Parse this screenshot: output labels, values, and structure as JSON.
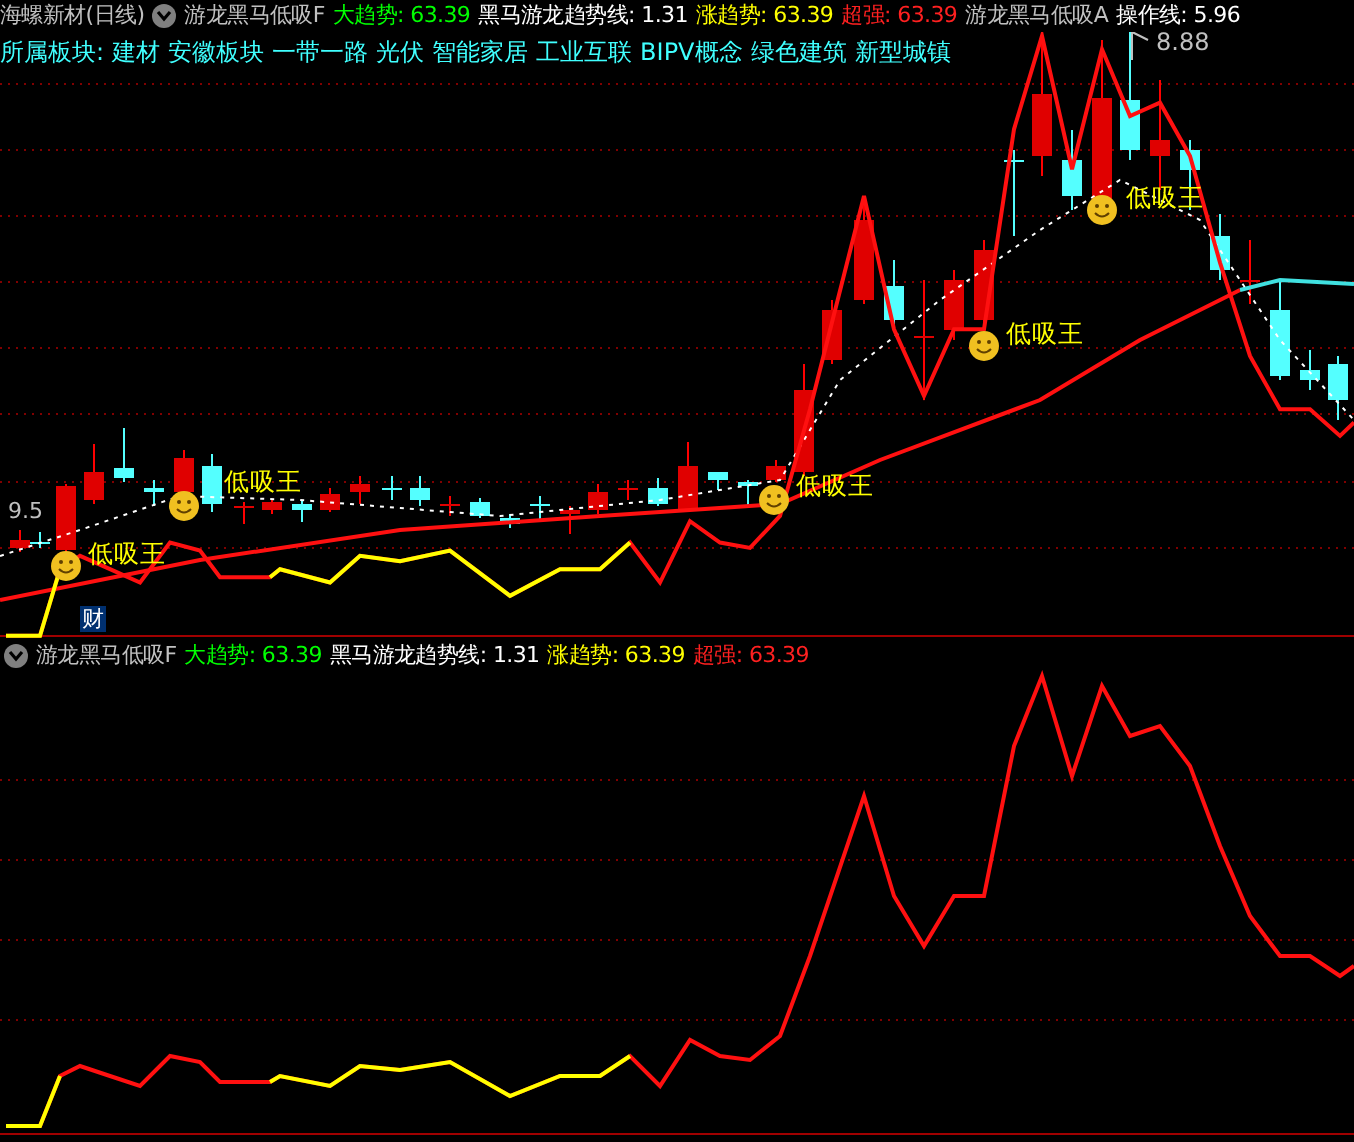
{
  "main_panel": {
    "title": "海螺新材(日线)",
    "indicator": "游龙黑马低吸F",
    "values": [
      {
        "text": "大趋势: 63.39",
        "color": "#00ff00"
      },
      {
        "text": "黑马游龙趋势线: 1.31",
        "color": "#ffffff"
      },
      {
        "text": "涨趋势: 63.39",
        "color": "#ffff00"
      },
      {
        "text": "超强: 63.39",
        "color": "#ff2020"
      },
      {
        "text": "游龙黑马低吸A",
        "color": "#c0c0c0"
      },
      {
        "text": "操作线: 5.96",
        "color": "#ffffff"
      }
    ],
    "sector_label": "所属板块:",
    "sectors": [
      "建材",
      "安徽板块",
      "一带一路",
      "光伏",
      "智能家居",
      "工业互联",
      "BIPV概念",
      "绿色建筑",
      "新型城镇"
    ],
    "high_price": "8.88",
    "low_price": "9.5",
    "signals": [
      "低吸王",
      "低吸王",
      "低吸王",
      "低吸王",
      "低吸王"
    ],
    "finance_badge": "财"
  },
  "sub_panel": {
    "indicator": "游龙黑马低吸F",
    "values": [
      {
        "text": "大趋势: 63.39",
        "color": "#00ff00"
      },
      {
        "text": "黑马游龙趋势线: 1.31",
        "color": "#ffffff"
      },
      {
        "text": "涨趋势: 63.39",
        "color": "#ffff00"
      },
      {
        "text": "超强: 63.39",
        "color": "#ff2020"
      }
    ]
  }
}
